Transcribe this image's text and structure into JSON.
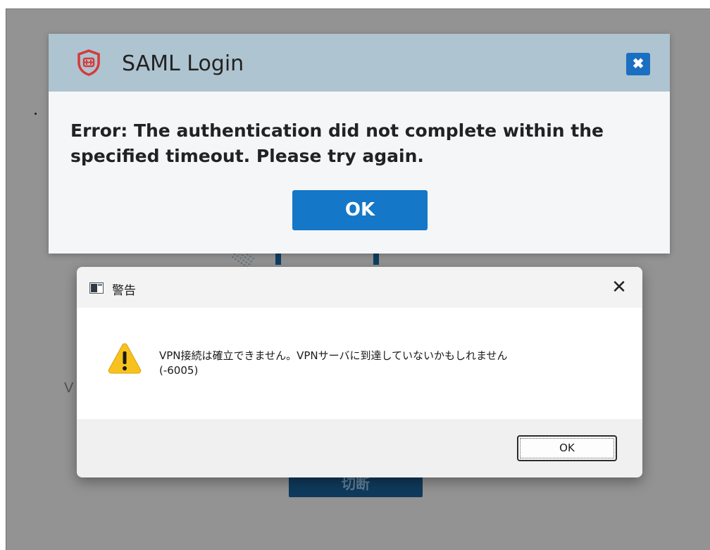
{
  "saml_dialog": {
    "title": "SAML Login",
    "logo_icon": "forticlient-shield-icon",
    "close_icon": "close-x-icon",
    "close_symbol": "✖",
    "message": "Error: The authentication did not complete within the specified timeout. Please try again.",
    "ok_label": "OK",
    "accent_color": "#1477c7",
    "header_color": "#aec4d0"
  },
  "warning_dialog": {
    "title": "警告",
    "app_icon": "window-app-icon",
    "close_symbol": "✕",
    "warning_icon": "warning-triangle-icon",
    "message_line1": "VPN接続は確立できません。VPNサーバに到達していないかもしれません",
    "message_line2": "(-6005)",
    "ok_label": "OK"
  },
  "background_app": {
    "partial_letter": "V",
    "partial_button_label": "切断"
  }
}
